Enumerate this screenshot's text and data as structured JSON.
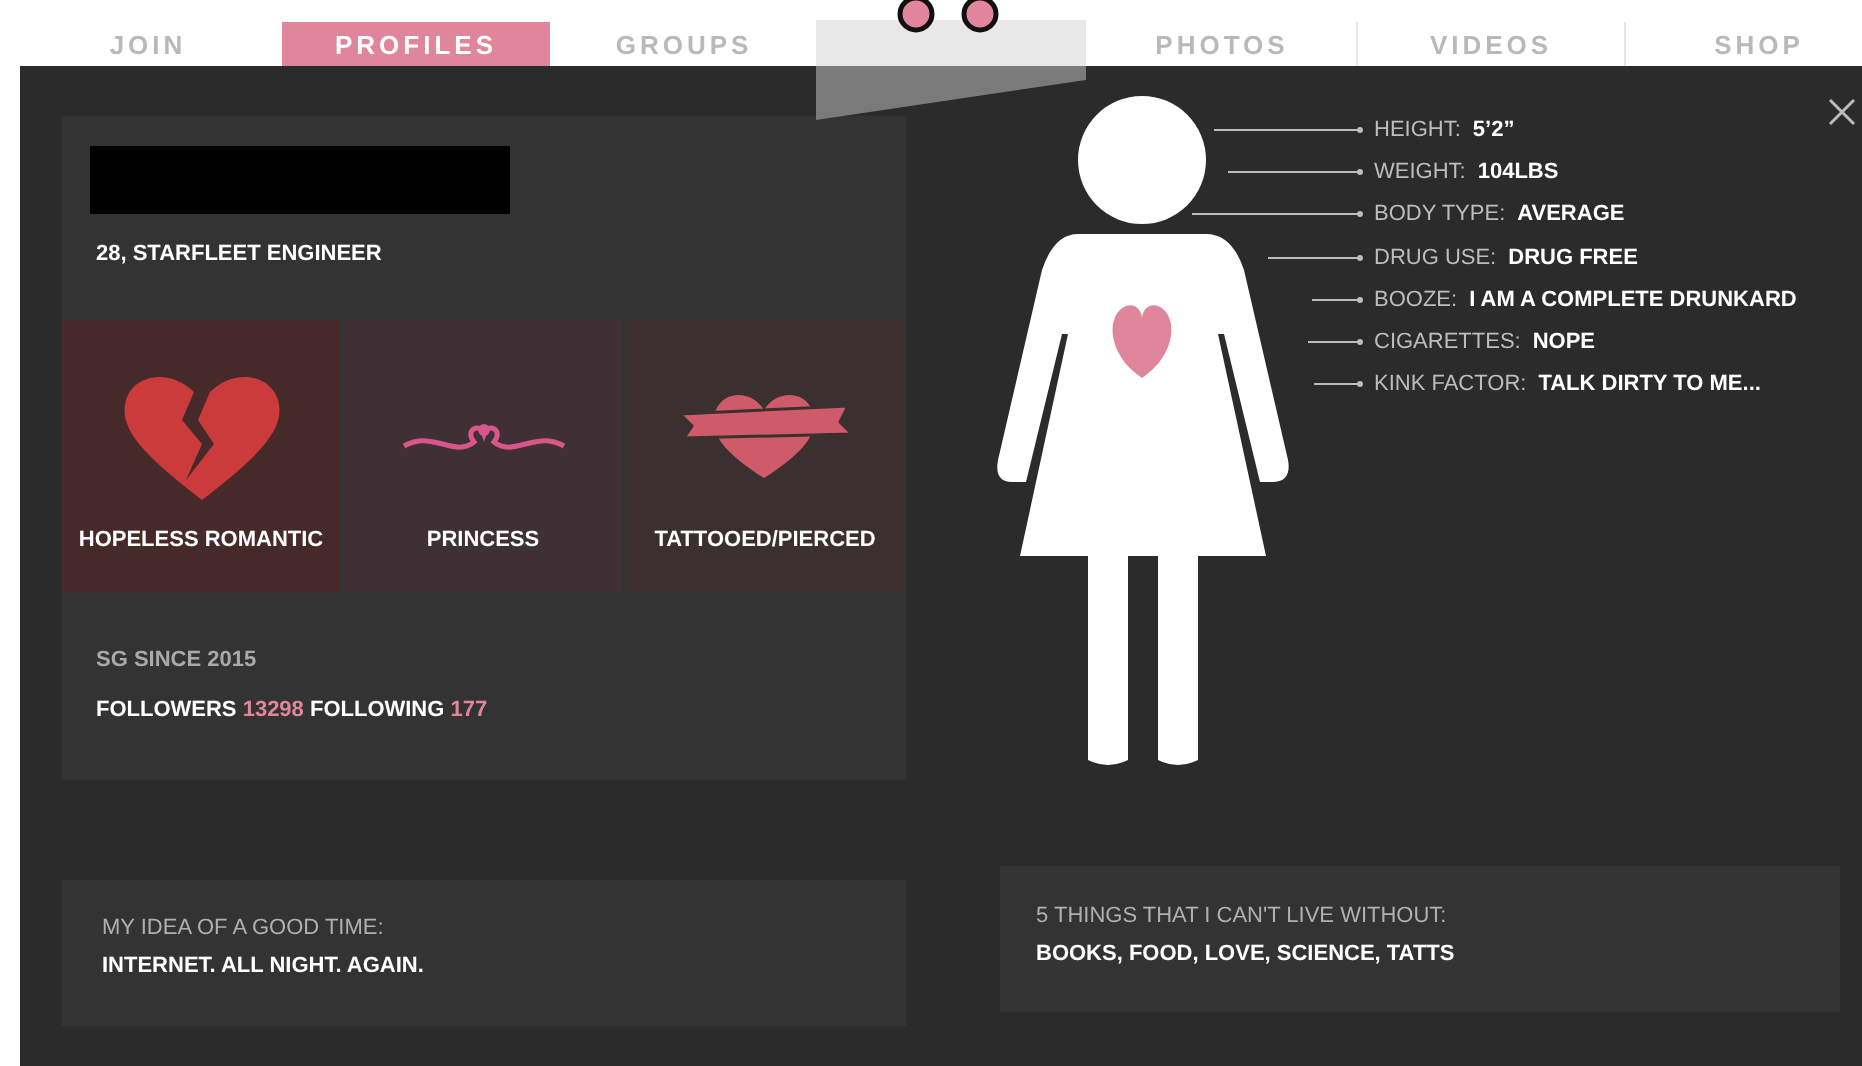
{
  "nav": [
    {
      "label": "JOIN",
      "selected": false
    },
    {
      "label": "PROFILES",
      "selected": true
    },
    {
      "label": "GROUPS",
      "selected": false
    },
    {
      "label": "PHOTOS",
      "selected": false
    },
    {
      "label": "VIDEOS",
      "selected": false
    },
    {
      "label": "SHOP",
      "selected": false
    }
  ],
  "profile": {
    "subtitle": "28, STARFLEET ENGINEER",
    "tiles": [
      {
        "label": "HOPELESS ROMANTIC",
        "kind": "broken-heart"
      },
      {
        "label": "PRINCESS",
        "kind": "ornament"
      },
      {
        "label": "TATTOOED/PIERCED",
        "kind": "heart-banner"
      }
    ],
    "since": "SG SINCE 2015",
    "followers_label": "FOLLOWERS",
    "followers": "13298",
    "following_label": "FOLLOWING",
    "following": "177"
  },
  "stats": [
    {
      "label": "HEIGHT:",
      "value": "5’2”"
    },
    {
      "label": "WEIGHT:",
      "value": "104LBS"
    },
    {
      "label": "BODY TYPE:",
      "value": "AVERAGE"
    },
    {
      "label": "DRUG USE:",
      "value": "DRUG FREE"
    },
    {
      "label": "BOOZE:",
      "value": "I AM A COMPLETE DRUNKARD"
    },
    {
      "label": "CIGARETTES:",
      "value": "NOPE"
    },
    {
      "label": "KINK FACTOR:",
      "value": "TALK DIRTY TO ME..."
    }
  ],
  "cards": [
    {
      "label": "MY IDEA OF A GOOD TIME:",
      "value": "INTERNET. ALL NIGHT. AGAIN."
    },
    {
      "label": "5 THINGS THAT I CAN'T LIVE WITHOUT:",
      "value": "BOOKS, FOOD, LOVE, SCIENCE, TATTS"
    }
  ]
}
